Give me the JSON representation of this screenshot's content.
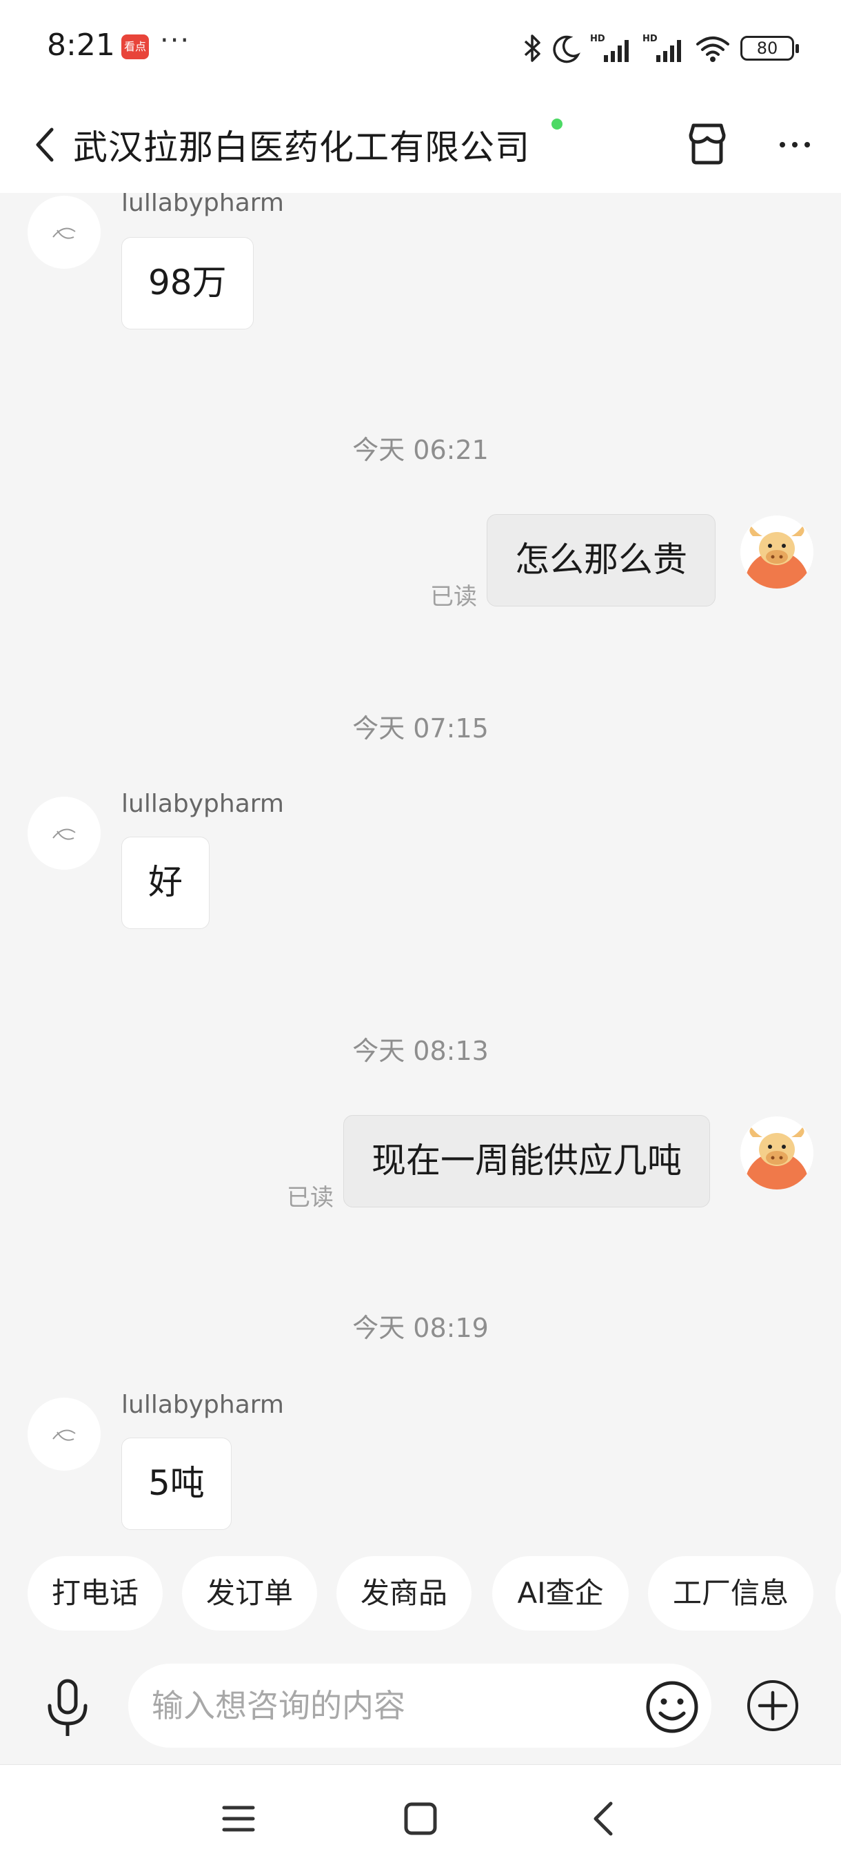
{
  "status_bar": {
    "time": "8:21",
    "app_icon_text": "看点",
    "overflow_dots": "···",
    "battery_level": "80",
    "icons": [
      "bluetooth-icon",
      "moon-icon",
      "hd-signal-icon",
      "hd-signal-icon",
      "wifi-icon",
      "battery-icon"
    ]
  },
  "header": {
    "title": "武汉拉那白医药化工有限公司",
    "online_color": "#4cd964"
  },
  "messages": {
    "m1": {
      "sender": "lullabypharm",
      "text": "98万"
    },
    "t1": "今天  06:21",
    "m2": {
      "text": "怎么那么贵",
      "status": "已读"
    },
    "t2": "今天  07:15",
    "m3": {
      "sender": "lullabypharm",
      "text": "好"
    },
    "t3": "今天  08:13",
    "m4": {
      "text": "现在一周能供应几吨",
      "status": "已读"
    },
    "t4": "今天  08:19",
    "m5": {
      "sender": "lullabypharm",
      "text": "5吨"
    }
  },
  "quick_actions": [
    "打电话",
    "发订单",
    "发商品",
    "AI查企",
    "工厂信息"
  ],
  "input": {
    "placeholder": "输入想咨询的内容"
  },
  "colors": {
    "background": "#f5f5f5",
    "outgoing_bubble": "#ececec",
    "avatar_orange": "#f0794a"
  }
}
